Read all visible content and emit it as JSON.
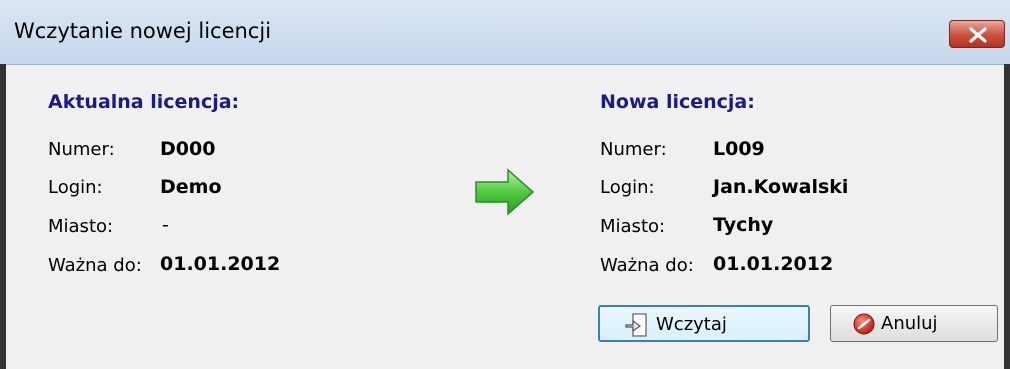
{
  "window": {
    "title": "Wczytanie nowej licencji"
  },
  "current": {
    "heading": "Aktualna licencja:",
    "numer_label": "Numer:",
    "numer_value": "D000",
    "login_label": "Login:",
    "login_value": "Demo",
    "miasto_label": "Miasto:",
    "miasto_value": "-",
    "wazna_label": "Ważna do:",
    "wazna_value": "01.01.2012"
  },
  "new": {
    "heading": "Nowa licencja:",
    "numer_label": "Numer:",
    "numer_value": "L009",
    "login_label": "Login:",
    "login_value": "Jan.Kowalski",
    "miasto_label": "Miasto:",
    "miasto_value": "Tychy",
    "wazna_label": "Ważna do:",
    "wazna_value": "01.01.2012"
  },
  "buttons": {
    "load_label": "Wczytaj",
    "cancel_label": "Anuluj"
  },
  "icons": {
    "arrow": "arrow-right-icon",
    "close": "close-icon",
    "load": "load-document-icon",
    "cancel": "cancel-icon"
  },
  "colors": {
    "heading": "#1a1a8c",
    "arrow": "#3dbb3d",
    "close_button": "#c8513b",
    "cancel_icon": "#cc2a1a"
  }
}
